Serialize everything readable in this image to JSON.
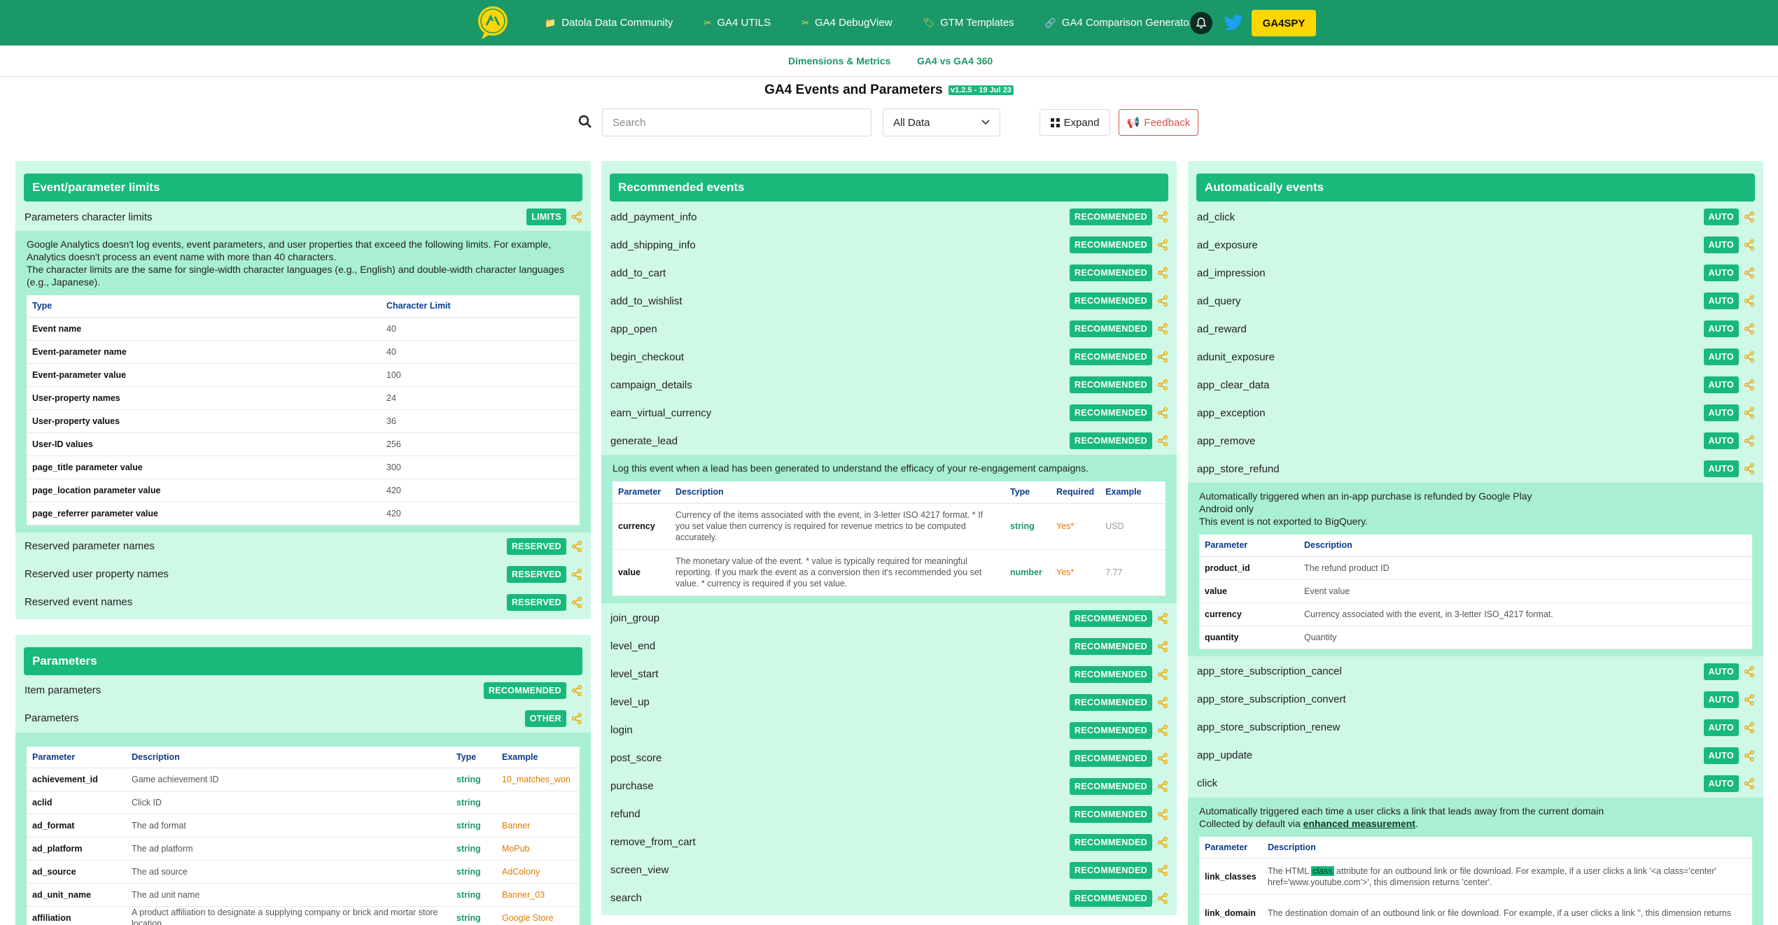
{
  "nav": {
    "links": [
      {
        "label": "Datola Data Community",
        "icon": "folder-icon"
      },
      {
        "label": "GA4 UTILS",
        "icon": "tools-icon"
      },
      {
        "label": "GA4 DebugView",
        "icon": "tools-icon"
      },
      {
        "label": "GTM Templates",
        "icon": "tag-icon"
      },
      {
        "label": "GA4 Comparison Generator",
        "icon": "link-icon"
      }
    ],
    "spy_button": "GA4SPY"
  },
  "subnav": {
    "dims": "Dimensions & Metrics",
    "vs": "GA4 vs GA4 360"
  },
  "page": {
    "title": "GA4 Events and Parameters",
    "version": "v1.2.5 - 19 Jul 23"
  },
  "search": {
    "placeholder": "Search",
    "select_value": "All Data",
    "expand": "Expand",
    "feedback": "Feedback"
  },
  "colors": {
    "brand": "#1b9867",
    "accent": "#18b97a",
    "card": "#cff8e6",
    "detail": "#a9f0d2",
    "warning": "#d9534f"
  },
  "limits": {
    "title": "Event/parameter limits",
    "row1": {
      "label": "Parameters character limits",
      "badge": "LIMITS"
    },
    "desc1": "Google Analytics doesn't log events, event parameters, and user properties that exceed the following limits. For example, Analytics doesn't process an event name with more than 40 characters.",
    "desc2": "The character limits are the same for single-width character languages (e.g., English) and double-width character languages (e.g., Japanese).",
    "th_type": "Type",
    "th_limit": "Character Limit",
    "rows": [
      [
        "Event name",
        "40"
      ],
      [
        "Event-parameter name",
        "40"
      ],
      [
        "Event-parameter value",
        "100"
      ],
      [
        "User-property names",
        "24"
      ],
      [
        "User-property values",
        "36"
      ],
      [
        "User-ID values",
        "256"
      ],
      [
        "page_title parameter value",
        "300"
      ],
      [
        "page_location parameter value",
        "420"
      ],
      [
        "page_referrer parameter value",
        "420"
      ]
    ],
    "reserved": [
      {
        "label": "Reserved parameter names",
        "badge": "RESERVED"
      },
      {
        "label": "Reserved user property names",
        "badge": "RESERVED"
      },
      {
        "label": "Reserved event names",
        "badge": "RESERVED"
      }
    ]
  },
  "params": {
    "title": "Parameters",
    "rows": [
      {
        "label": "Item parameters",
        "badge": "RECOMMENDED"
      },
      {
        "label": "Parameters",
        "badge": "OTHER"
      }
    ],
    "th": [
      "Parameter",
      "Description",
      "Type",
      "Example"
    ],
    "table": [
      [
        "achievement_id",
        "Game achievement ID",
        "string",
        "10_matches_won"
      ],
      [
        "aclid",
        "Click ID",
        "string",
        ""
      ],
      [
        "ad_format",
        "The ad format",
        "string",
        "Banner"
      ],
      [
        "ad_platform",
        "The ad platform",
        "string",
        "MoPub"
      ],
      [
        "ad_source",
        "The ad source",
        "string",
        "AdColony"
      ],
      [
        "ad_unit_name",
        "The ad unit name",
        "string",
        "Banner_03"
      ],
      [
        "affiliation",
        "A product affiliation to designate a supplying company or brick and mortar store location.",
        "string",
        "Google Store"
      ]
    ]
  },
  "recommended": {
    "title": "Recommended events",
    "badge": "RECOMMENDED",
    "events_top": [
      "add_payment_info",
      "add_shipping_info",
      "add_to_cart",
      "add_to_wishlist",
      "app_open",
      "begin_checkout",
      "campaign_details",
      "earn_virtual_currency",
      "generate_lead"
    ],
    "detail_text": "Log this event when a lead has been generated to understand the efficacy of your re-engagement campaigns.",
    "th": [
      "Parameter",
      "Description",
      "Type",
      "Required",
      "Example"
    ],
    "table": [
      [
        "currency",
        "Currency of the items associated with the event, in 3-letter ISO 4217 format. * If you set value then currency is required for revenue metrics to be computed accurately.",
        "string",
        "Yes*",
        "USD"
      ],
      [
        "value",
        "The monetary value of the event. * value is typically required for meaningful reporting. If you mark the event as a conversion then it's recommended you set value. * currency is required if you set value.",
        "number",
        "Yes*",
        "7.77"
      ]
    ],
    "events_bottom": [
      "join_group",
      "level_end",
      "level_start",
      "level_up",
      "login",
      "post_score",
      "purchase",
      "refund",
      "remove_from_cart",
      "screen_view",
      "search"
    ]
  },
  "auto": {
    "title": "Automatically events",
    "badge": "AUTO",
    "events_top": [
      "ad_click",
      "ad_exposure",
      "ad_impression",
      "ad_query",
      "ad_reward",
      "adunit_exposure",
      "app_clear_data",
      "app_exception",
      "app_remove",
      "app_store_refund"
    ],
    "detail1": [
      "Automatically triggered when an in-app purchase is refunded by Google Play",
      "Android only",
      "This event is not exported to BigQuery."
    ],
    "th": [
      "Parameter",
      "Description"
    ],
    "table1": [
      [
        "product_id",
        "The refund product ID"
      ],
      [
        "value",
        "Event value"
      ],
      [
        "currency",
        "Currency associated with the event, in 3-letter ISO_4217 format."
      ],
      [
        "quantity",
        "Quantity"
      ]
    ],
    "events_mid": [
      "app_store_subscription_cancel",
      "app_store_subscription_convert",
      "app_store_subscription_renew",
      "app_update",
      "click"
    ],
    "detail2_line1": "Automatically triggered each time a user clicks a link that leads away from the current domain",
    "detail2_prefix": "Collected by default via",
    "detail2_link": "enhanced measurement",
    "table2": [
      {
        "k": "link_classes",
        "a": "The HTML ",
        "hl": "class",
        "b": " attribute for an outbound link or file download. For example, if a user clicks a link '<a class='center' href='www.youtube.com'>', this dimension returns 'center'."
      },
      {
        "k": "link_domain",
        "a": "The destination domain of an outbound link or file download. For example, if a user clicks a link '",
        "hl": "",
        "b": "', this dimension returns"
      }
    ]
  }
}
